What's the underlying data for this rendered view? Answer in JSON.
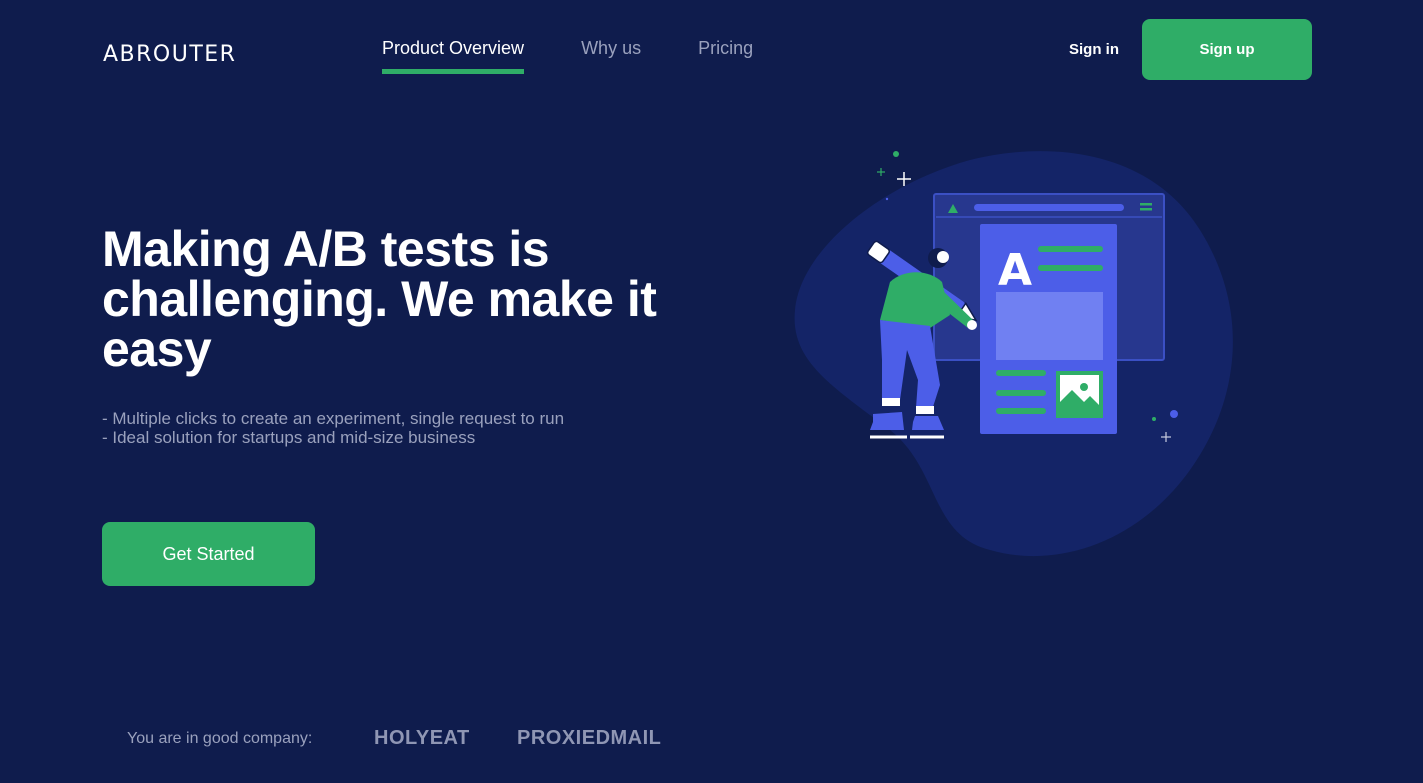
{
  "header": {
    "logo": "ABROUTER",
    "nav": [
      {
        "label": "Product Overview",
        "active": true
      },
      {
        "label": "Why us",
        "active": false
      },
      {
        "label": "Pricing",
        "active": false
      }
    ],
    "sign_in": "Sign in",
    "sign_up": "Sign up"
  },
  "hero": {
    "title": "Making A/B tests is challenging. We make it easy",
    "bullets": [
      "- Multiple clicks to create an experiment, single request to run",
      "- Ideal solution for startups and mid-size business"
    ],
    "cta": "Get Started"
  },
  "illustration": {
    "letter": "A"
  },
  "companies": {
    "label": "You are in good company:",
    "logos": [
      "HOLYEAT",
      "PROXIEDMAIL"
    ]
  },
  "colors": {
    "background": "#0f1c4d",
    "accent": "#2fad67",
    "muted_text": "#9aa1bd"
  }
}
